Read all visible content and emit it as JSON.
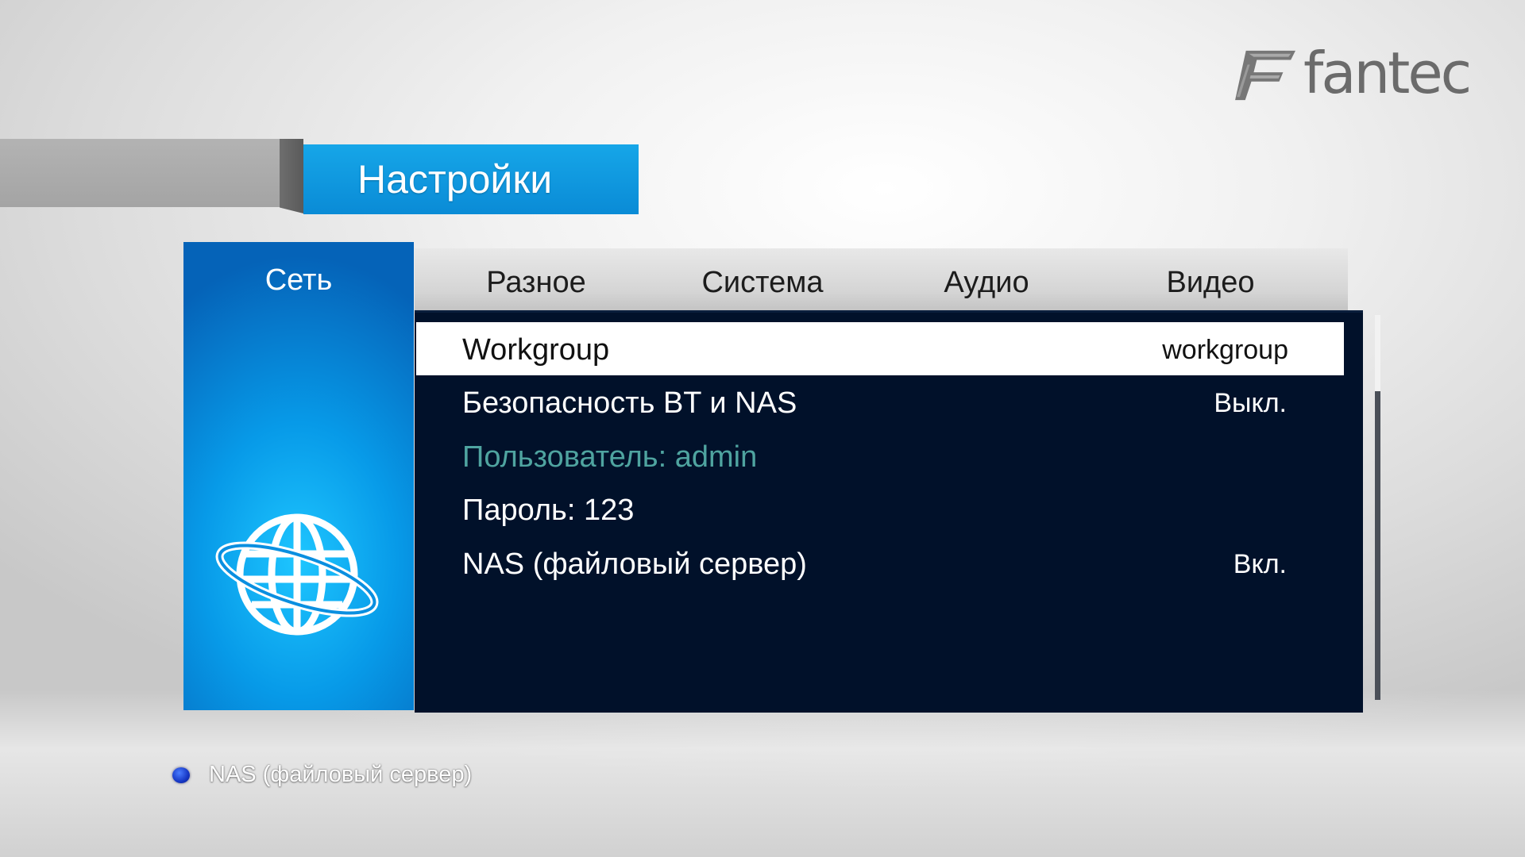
{
  "logo": {
    "text": "fantec",
    "icon": "fantec-f-logo"
  },
  "header": {
    "title": "Настройки"
  },
  "category": {
    "label": "Сеть",
    "icon": "globe-icon"
  },
  "tabs": [
    {
      "label": "Разное"
    },
    {
      "label": "Система"
    },
    {
      "label": "Аудио"
    },
    {
      "label": "Видео"
    }
  ],
  "settings": [
    {
      "label": "Workgroup",
      "value": "workgroup",
      "selected": true
    },
    {
      "label": "Безопасность BT и NAS",
      "value": "Выкл."
    },
    {
      "label": "Пользователь: admin",
      "value": "",
      "disabled": true
    },
    {
      "label": "Пароль: 123",
      "value": ""
    },
    {
      "label": "NAS (файловый сервер)",
      "value": "Вкл."
    }
  ],
  "hint": {
    "text": "NAS (файловый сервер)",
    "dot_color": "#1d45d8"
  },
  "colors": {
    "accent_blue": "#0a8bd6",
    "panel_dark": "#01112a",
    "dim_text": "#4fa4a0"
  }
}
